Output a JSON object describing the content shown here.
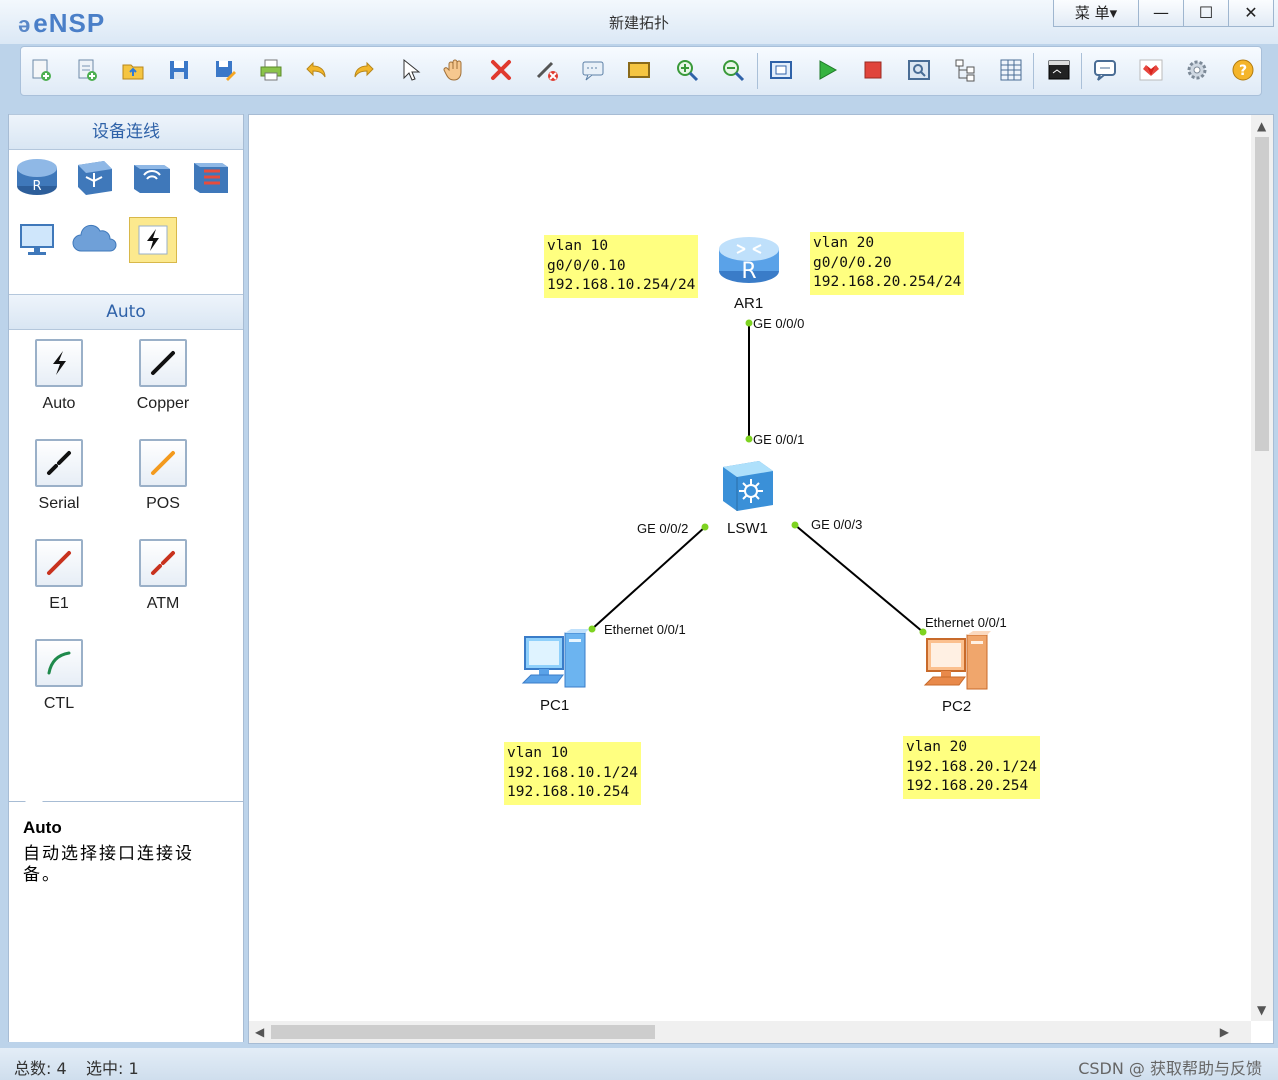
{
  "app": {
    "logo": "eNSP",
    "title": "新建拓扑"
  },
  "window_controls": {
    "menu": "菜 单▾",
    "minimize": "—",
    "maximize": "☐",
    "close": "✕"
  },
  "toolbar": {
    "buttons": [
      "new-topology",
      "new-template",
      "open",
      "save",
      "save-as",
      "print",
      "undo",
      "redo",
      "select",
      "pan",
      "delete",
      "delete-link",
      "text",
      "rectangle",
      "zoom-in",
      "zoom-out",
      "fit",
      "start",
      "stop",
      "capture",
      "topology",
      "grid",
      "console",
      "feedback",
      "huawei",
      "settings",
      "help"
    ]
  },
  "left_panel": {
    "device_header": "设备连线",
    "devices": [
      "router",
      "switch",
      "wlan",
      "firewall",
      "pc",
      "cloud",
      "auto-link"
    ],
    "cable_header": "Auto",
    "cables": [
      {
        "id": "auto",
        "label": "Auto",
        "color": "#111111"
      },
      {
        "id": "copper",
        "label": "Copper",
        "color": "#111111"
      },
      {
        "id": "serial",
        "label": "Serial",
        "color": "#111111"
      },
      {
        "id": "pos",
        "label": "POS",
        "color": "#f39a1e"
      },
      {
        "id": "e1",
        "label": "E1",
        "color": "#c8321e"
      },
      {
        "id": "atm",
        "label": "ATM",
        "color": "#c8321e"
      },
      {
        "id": "ctl",
        "label": "CTL",
        "color": "#1f8a4c"
      }
    ],
    "description": {
      "title": "Auto",
      "text": "自动选择接口连接设备。"
    }
  },
  "topology": {
    "devices": [
      {
        "id": "AR1",
        "label": "AR1",
        "type": "router"
      },
      {
        "id": "LSW1",
        "label": "LSW1",
        "type": "switch"
      },
      {
        "id": "PC1",
        "label": "PC1",
        "type": "pc"
      },
      {
        "id": "PC2",
        "label": "PC2",
        "type": "pc"
      }
    ],
    "ports": {
      "ar1_ge000": "GE 0/0/0",
      "lsw1_ge001": "GE 0/0/1",
      "lsw1_ge002": "GE 0/0/2",
      "lsw1_ge003": "GE 0/0/3",
      "pc1_eth": "Ethernet 0/0/1",
      "pc2_eth": "Ethernet 0/0/1"
    },
    "notes": {
      "ar1_vlan10": [
        "vlan 10",
        "g0/0/0.10",
        "192.168.10.254/24"
      ],
      "ar1_vlan20": [
        "vlan 20",
        "g0/0/0.20",
        "192.168.20.254/24"
      ],
      "pc1": [
        "vlan 10",
        "192.168.10.1/24",
        "192.168.10.254"
      ],
      "pc2": [
        "vlan 20",
        "192.168.20.1/24",
        "192.168.20.254"
      ]
    },
    "colors": {
      "port_dot": "#7ed321",
      "note_bg": "#ffff80",
      "link": "#000000"
    }
  },
  "status_bar": {
    "total": "总数: 4",
    "selected": "选中: 1",
    "watermark": "CSDN @ 获取帮助与反馈"
  }
}
